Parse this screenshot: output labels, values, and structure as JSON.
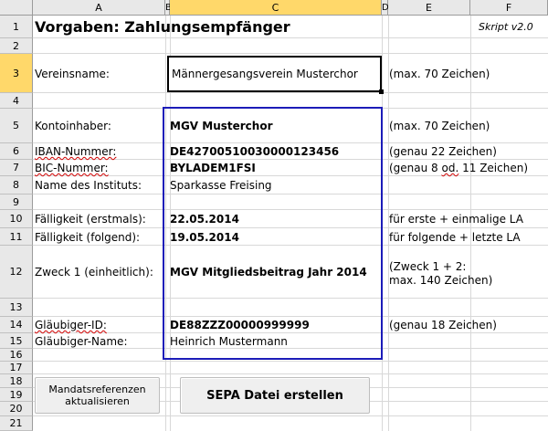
{
  "sheet": {
    "columns": [
      "A",
      "B",
      "C",
      "D",
      "E",
      "F"
    ],
    "selected_column": "C",
    "rows": [
      "1",
      "2",
      "3",
      "4",
      "5",
      "6",
      "7",
      "8",
      "9",
      "10",
      "11",
      "12",
      "13",
      "14",
      "15",
      "16",
      "17",
      "18",
      "19",
      "20",
      "21"
    ],
    "selected_row": "3"
  },
  "colors": {
    "selection_header": "#ffd86a",
    "range_border": "#1c1cb8",
    "spell_underline": "#d00000"
  },
  "title": "Vorgaben: Zahlungsempfänger",
  "version": "Skript v2.0",
  "fields": {
    "vereinsname": {
      "label": "Vereinsname:",
      "value": "Männergesangsverein Musterchor",
      "hint": "(max. 70 Zeichen)"
    },
    "kontoinhaber": {
      "label": "Kontoinhaber:",
      "value": "MGV Musterchor",
      "hint": "(max. 70 Zeichen)"
    },
    "iban": {
      "label": "IBAN-Nummer:",
      "value": "DE42700510030000123456",
      "hint": "(genau 22 Zeichen)"
    },
    "bic": {
      "label": "BIC-Nummer:",
      "value": "BYLADEM1FSI",
      "hint_pre": "(genau 8 ",
      "hint_squig": "od.",
      "hint_post": " 11 Zeichen)"
    },
    "institut": {
      "label": "Name des Instituts:",
      "value": "Sparkasse Freising"
    },
    "faelligkeit_erst": {
      "label": "Fälligkeit (erstmals):",
      "value": "22.05.2014",
      "hint": "für erste + einmalige LA"
    },
    "faelligkeit_folg": {
      "label": "Fälligkeit (folgend):",
      "value": "19.05.2014",
      "hint": "für folgende + letzte LA"
    },
    "zweck": {
      "label": "Zweck 1 (einheitlich):",
      "value": "MGV Mitgliedsbeitrag Jahr 2014",
      "hint_line1": "(Zweck 1 + 2:",
      "hint_line2": "max. 140 Zeichen)"
    },
    "glaeubiger_id": {
      "label": "Gläubiger-ID:",
      "value": "DE88ZZZ00000999999",
      "hint": "(genau 18 Zeichen)"
    },
    "glaeubiger_name": {
      "label": "Gläubiger-Name:",
      "value": "Heinrich Mustermann"
    }
  },
  "buttons": {
    "mandate_line1": "Mandatsreferenzen",
    "mandate_line2": "aktualisieren",
    "sepa": "SEPA Datei erstellen"
  }
}
